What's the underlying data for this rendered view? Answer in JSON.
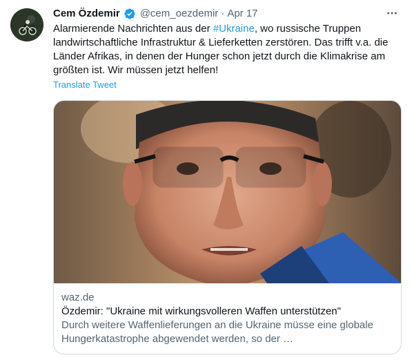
{
  "tweet": {
    "author_name": "Cem Özdemir",
    "handle": "@cem_oezdemir",
    "separator": "·",
    "date": "Apr 17",
    "text_segments": [
      {
        "text": "Alarmierende Nachrichten aus der ",
        "type": "plain"
      },
      {
        "text": "#Ukraine",
        "type": "hashtag"
      },
      {
        "text": ", wo russische Truppen landwirtschaftliche Infrastruktur & Lieferketten zerstören. Das trifft v.a. die Länder Afrikas, in denen der Hunger schon jetzt durch die Klimakrise am größten ist. Wir müssen jetzt helfen!",
        "type": "plain"
      }
    ],
    "translate_label": "Translate Tweet"
  },
  "card": {
    "domain": "waz.de",
    "title": "Özdemir: \"Ukraine mit wirkungsvolleren Waffen unterstützen\"",
    "description": "Durch weitere Waffenlieferungen an die Ukraine müsse eine globale Hungerkatastrophe abgewendet werden, so der …"
  },
  "icons": {
    "verified": "verified-badge-icon",
    "more": "more-options-icon"
  },
  "colors": {
    "link": "#1d9bf0",
    "text": "#0f1419",
    "secondary": "#536471",
    "border": "#cfd9de"
  }
}
